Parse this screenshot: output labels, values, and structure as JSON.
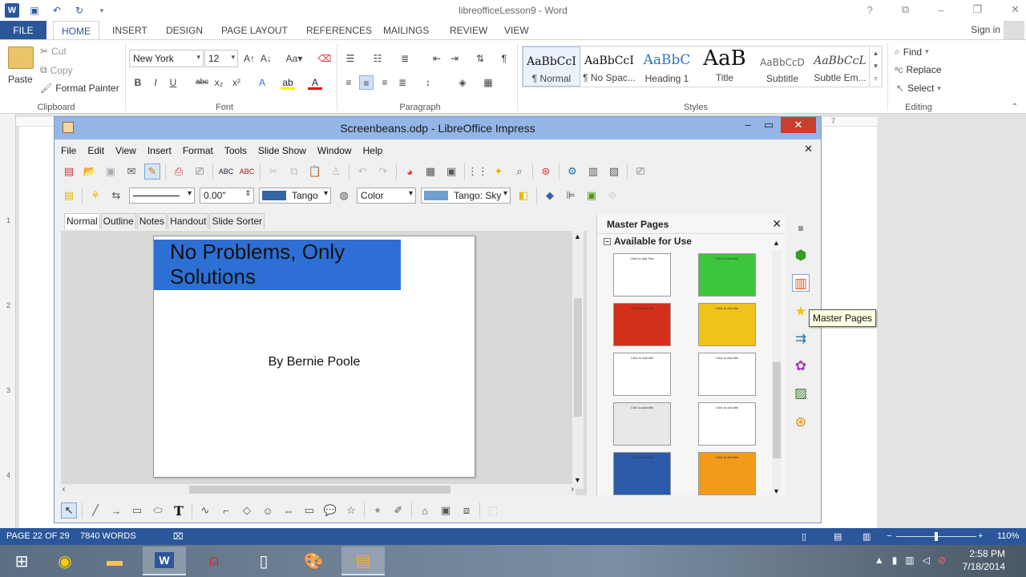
{
  "word": {
    "title": "libreofficeLesson9 - Word",
    "window_controls": [
      "?",
      "⧉",
      "–",
      "❐",
      "✕"
    ],
    "tabs": [
      "FILE",
      "HOME",
      "INSERT",
      "DESIGN",
      "PAGE LAYOUT",
      "REFERENCES",
      "MAILINGS",
      "REVIEW",
      "VIEW"
    ],
    "active_tab": "HOME",
    "sign_in": "Sign in",
    "ribbon": {
      "clipboard": {
        "paste": "Paste",
        "cut": "Cut",
        "copy": "Copy",
        "format_painter": "Format Painter",
        "label": "Clipboard"
      },
      "font": {
        "name": "New York",
        "size": "12",
        "label": "Font"
      },
      "paragraph": {
        "label": "Paragraph"
      },
      "styles": {
        "label": "Styles",
        "items": [
          {
            "preview": "AaBbCcI",
            "name": "¶ Normal"
          },
          {
            "preview": "AaBbCcI",
            "name": "¶ No Spac..."
          },
          {
            "preview": "AaBbC",
            "name": "Heading 1"
          },
          {
            "preview": "AaB",
            "name": "Title"
          },
          {
            "preview": "AaBbCcD",
            "name": "Subtitle"
          },
          {
            "preview": "AaBbCcL",
            "name": "Subtle Em..."
          }
        ]
      },
      "editing": {
        "find": "Find",
        "replace": "Replace",
        "select": "Select",
        "label": "Editing"
      }
    },
    "ruler_mark": "7",
    "ruler_v": [
      "1",
      "2",
      "3",
      "4"
    ],
    "status": {
      "page": "PAGE 22 OF 29",
      "words": "7840 WORDS",
      "zoom": "110%"
    }
  },
  "lo": {
    "title": "Screenbeans.odp - LibreOffice Impress",
    "menu": [
      "File",
      "Edit",
      "View",
      "Insert",
      "Format",
      "Tools",
      "Slide Show",
      "Window",
      "Help"
    ],
    "line_width": "0.00\"",
    "line_color": "Tango",
    "fill_type": "Color",
    "fill_color": "Tango: Sky",
    "view_tabs": [
      "Normal",
      "Outline",
      "Notes",
      "Handout",
      "Slide Sorter"
    ],
    "active_view": "Normal",
    "slide": {
      "title": "No Problems, Only Solutions",
      "subtitle": "By Bernie Poole"
    },
    "panel": {
      "title": "Master Pages",
      "section": "Available for Use",
      "masters": [
        {
          "label": "Click to add Title",
          "color": "#ffffff"
        },
        {
          "label": "Click to add title",
          "color": "#3cc63c"
        },
        {
          "label": "Click to add title",
          "color": "#d2301a"
        },
        {
          "label": "Click to add title",
          "color": "#f0c21c"
        },
        {
          "label": "Click to add title",
          "color": "#ffffff"
        },
        {
          "label": "Click to add title",
          "color": "#ffffff"
        },
        {
          "label": "Click to add title",
          "color": "#e8e8e8"
        },
        {
          "label": "Click to add title",
          "color": "#ffffff"
        },
        {
          "label": "Click to add title",
          "color": "#2b5aa8"
        },
        {
          "label": "Click to add title",
          "color": "#f29a1a"
        }
      ]
    },
    "tooltip": "Master Pages"
  },
  "taskbar": {
    "time": "2:58 PM",
    "date": "7/18/2014"
  }
}
